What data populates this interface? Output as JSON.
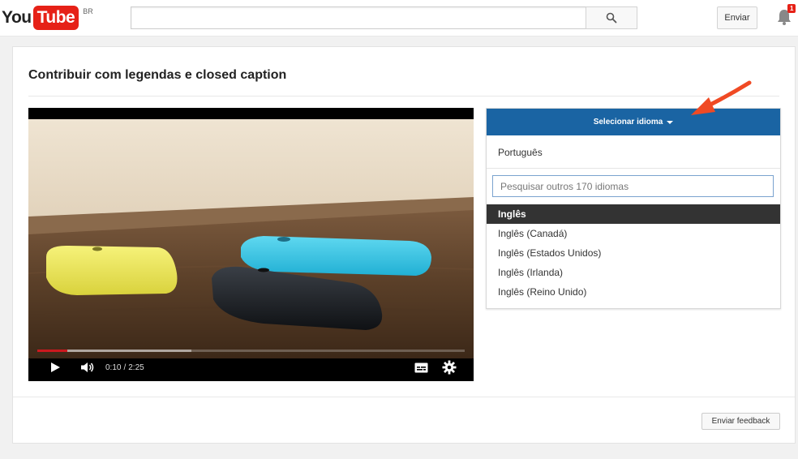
{
  "header": {
    "logo_you": "You",
    "logo_tube": "Tube",
    "country_code": "BR",
    "search_value": "",
    "search_icon": "search-icon",
    "upload_label": "Enviar",
    "notification_icon": "bell-icon",
    "notification_count": "1"
  },
  "page": {
    "title": "Contribuir com legendas e closed caption"
  },
  "player": {
    "current_time": "0:10",
    "separator": "/",
    "duration": "2:25",
    "played_fraction": 0.07,
    "buffered_fraction": 0.36,
    "controls": [
      "play-icon",
      "volume-icon",
      "subtitles-icon",
      "settings-icon"
    ]
  },
  "language_panel": {
    "header_label": "Selecionar idioma",
    "current_language": "Português",
    "search_placeholder": "Pesquisar outros 170 idiomas",
    "search_value": "",
    "items": [
      {
        "label": "Inglês",
        "selected": true
      },
      {
        "label": "Inglês (Canadá)",
        "selected": false
      },
      {
        "label": "Inglês (Estados Unidos)",
        "selected": false
      },
      {
        "label": "Inglês (Irlanda)",
        "selected": false
      },
      {
        "label": "Inglês (Reino Unido)",
        "selected": false
      }
    ]
  },
  "footer": {
    "feedback_label": "Enviar feedback"
  },
  "colors": {
    "brand_red": "#e62117",
    "panel_header_blue": "#1a64a3",
    "selected_row": "#333333",
    "progress_red": "#cc181e",
    "annotation_arrow": "#f04a24"
  }
}
